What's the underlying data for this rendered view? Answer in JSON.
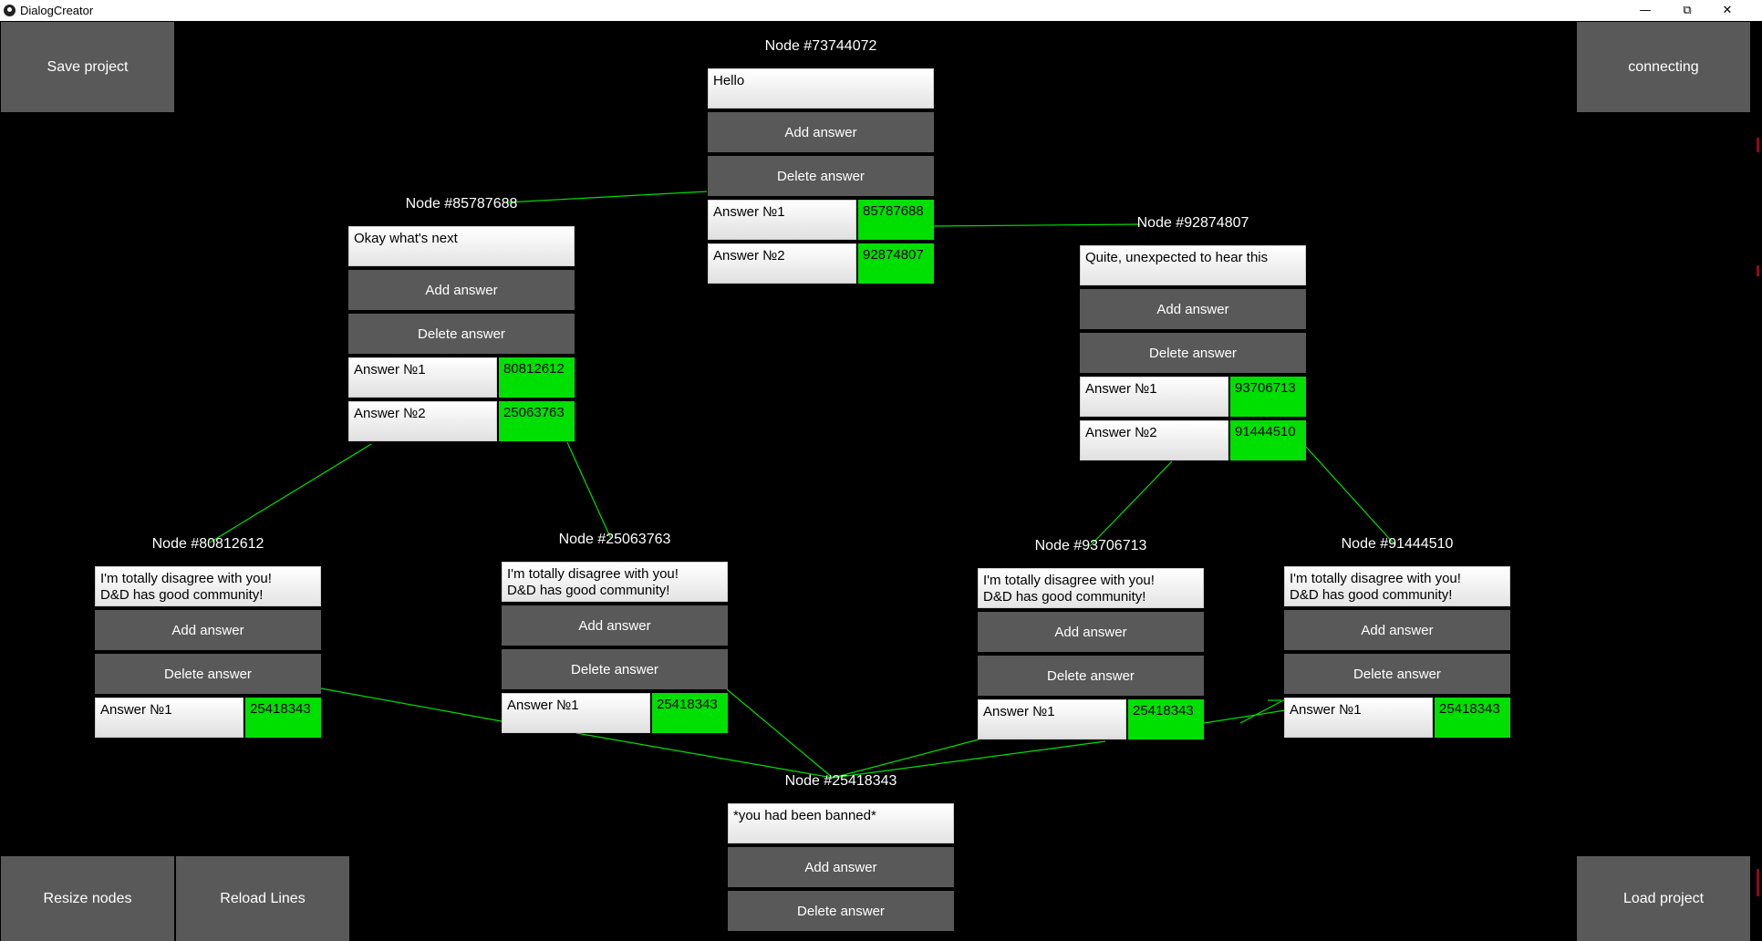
{
  "window": {
    "title": "DialogCreator",
    "minimize_icon": "minimize-icon",
    "restore_icon": "restore-icon",
    "close_icon": "close-icon"
  },
  "toolbar": {
    "save": "Save project",
    "status": "connecting",
    "resize": "Resize nodes",
    "reload": "Reload Lines",
    "load": "Load project"
  },
  "labels": {
    "add": "Add answer",
    "delete": "Delete answer"
  },
  "nodes": [
    {
      "title": "Node #73744072",
      "text": "Hello",
      "answers": [
        {
          "label": "Answer №1",
          "target": "85787688"
        },
        {
          "label": "Answer №2",
          "target": "92874807"
        }
      ]
    },
    {
      "title": "Node #85787688",
      "text": "Okay what's next",
      "answers": [
        {
          "label": "Answer №1",
          "target": "80812612"
        },
        {
          "label": "Answer №2",
          "target": "25063763"
        }
      ]
    },
    {
      "title": "Node #92874807",
      "text": "Quite, unexpected to hear this",
      "answers": [
        {
          "label": "Answer №1",
          "target": "93706713"
        },
        {
          "label": "Answer №2",
          "target": "91444510"
        }
      ]
    },
    {
      "title": "Node #80812612",
      "text": "I'm totally disagree with you!\nD&D has good community!",
      "answers": [
        {
          "label": "Answer №1",
          "target": "25418343"
        }
      ]
    },
    {
      "title": "Node #25063763",
      "text": "I'm totally disagree with you!\nD&D has good community!",
      "answers": [
        {
          "label": "Answer №1",
          "target": "25418343"
        }
      ]
    },
    {
      "title": "Node #93706713",
      "text": "I'm totally disagree with you!\nD&D has good community!",
      "answers": [
        {
          "label": "Answer №1",
          "target": "25418343"
        }
      ]
    },
    {
      "title": "Node #91444510",
      "text": "I'm totally disagree with you!\nD&D has good community!",
      "answers": [
        {
          "label": "Answer №1",
          "target": "25418343"
        }
      ]
    },
    {
      "title": "Node #25418343",
      "text": "*you had been banned*",
      "answers": []
    }
  ],
  "colors": {
    "background": "#000000",
    "button": "#595959",
    "target": "#00e000",
    "link": "#00e000"
  }
}
